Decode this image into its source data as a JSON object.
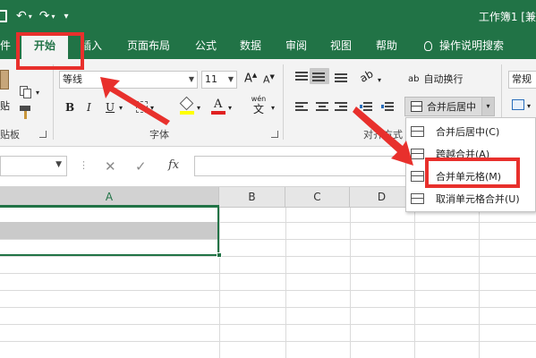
{
  "window": {
    "title": "工作簿1  [兼"
  },
  "qat": {
    "undo_icon": "undo-icon",
    "redo_icon": "redo-icon",
    "more": "▾"
  },
  "tabs": [
    {
      "label": "件"
    },
    {
      "label": "开始"
    },
    {
      "label": "插入"
    },
    {
      "label": "页面布局"
    },
    {
      "label": "公式"
    },
    {
      "label": "数据"
    },
    {
      "label": "审阅"
    },
    {
      "label": "视图"
    },
    {
      "label": "帮助"
    },
    {
      "label": "操作说明搜索"
    }
  ],
  "ribbon": {
    "clipboard": {
      "paste": "贴",
      "label": "贴板"
    },
    "font": {
      "name": "等线",
      "size": "11",
      "bold": "B",
      "italic": "I",
      "underline": "U",
      "label": "字体",
      "wen": "wén",
      "wen_char": "文",
      "font_color_letter": "A"
    },
    "alignment": {
      "wrap_text": "自动换行",
      "merge_center": "合并后居中",
      "label": "对齐方式"
    },
    "number": {
      "format": "常规"
    }
  },
  "menu": {
    "items": [
      {
        "label": "合并后居中(C)"
      },
      {
        "label": "跨越合并(A)"
      },
      {
        "label": "合并单元格(M)"
      },
      {
        "label": "取消单元格合并(U)"
      }
    ]
  },
  "formula": {
    "cancel": "✕",
    "enter": "✓",
    "fx": "fx"
  },
  "grid": {
    "columns": [
      "A",
      "B",
      "C",
      "D"
    ]
  },
  "colors": {
    "excel_green": "#217346",
    "annotation_red": "#e8302c"
  }
}
